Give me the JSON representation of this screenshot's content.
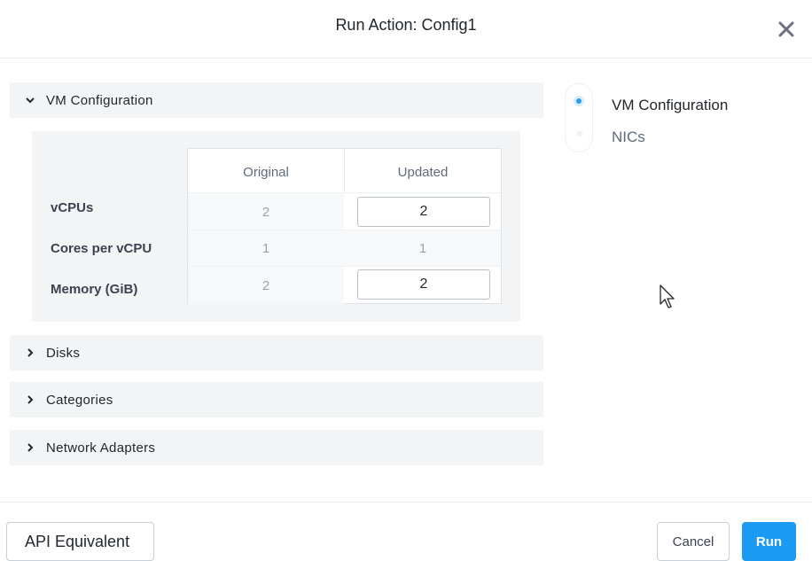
{
  "dialog": {
    "title": "Run Action: Config1"
  },
  "sections": {
    "vm_configuration": "VM Configuration",
    "disks": "Disks",
    "categories": "Categories",
    "network_adapters": "Network Adapters"
  },
  "config_table": {
    "headers": {
      "original": "Original",
      "updated": "Updated"
    },
    "rows": [
      {
        "label": "vCPUs",
        "original": "2",
        "updated": "2",
        "editable": true
      },
      {
        "label": "Cores per vCPU",
        "original": "1",
        "updated": "1",
        "editable": false
      },
      {
        "label": "Memory (GiB)",
        "original": "2",
        "updated": "2",
        "editable": true
      }
    ]
  },
  "stepper": {
    "steps": [
      {
        "label": "VM Configuration",
        "active": true
      },
      {
        "label": "NICs",
        "active": false
      }
    ]
  },
  "footer": {
    "api_label": "API Equivalent",
    "cancel_label": "Cancel",
    "run_label": "Run"
  },
  "colors": {
    "primary": "#1b9cf2",
    "active_step": "#2f9be9",
    "section_bg": "#f2f4f6",
    "inactive_text": "#5f6b7a"
  },
  "icons": [
    "close-icon",
    "chevron-down-icon",
    "chevron-right-icon",
    "mouse-cursor-icon"
  ]
}
